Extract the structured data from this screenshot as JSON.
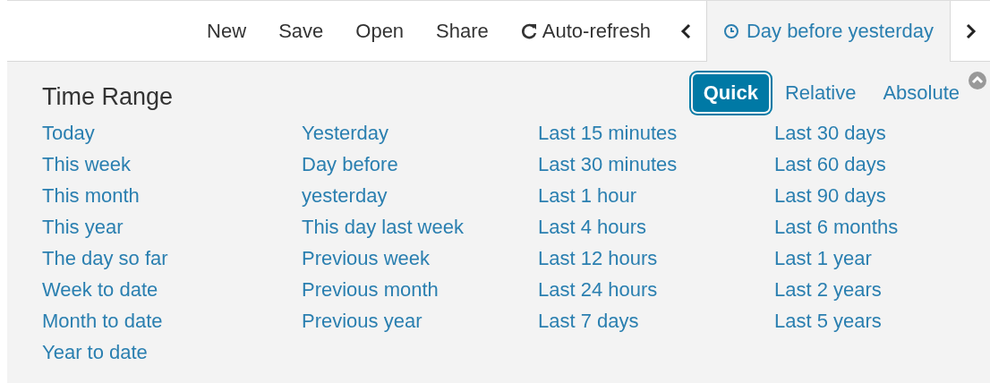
{
  "toolbar": {
    "items": [
      {
        "label": "New",
        "kind": "text"
      },
      {
        "label": "Save",
        "kind": "text"
      },
      {
        "label": "Open",
        "kind": "text"
      },
      {
        "label": "Share",
        "kind": "text"
      },
      {
        "label": "Auto-refresh",
        "kind": "refresh"
      }
    ],
    "time_picker": {
      "label": "Day before yesterday",
      "expanded": true
    }
  },
  "panel": {
    "title": "Time Range",
    "modes": [
      {
        "label": "Quick",
        "selected": true
      },
      {
        "label": "Relative",
        "selected": false
      },
      {
        "label": "Absolute",
        "selected": false
      }
    ],
    "columns": [
      [
        "Today",
        "This week",
        "This month",
        "This year",
        "The day so far",
        "Week to date",
        "Month to date",
        "Year to date"
      ],
      [
        "Yesterday",
        "Day before yesterday",
        "This day last week",
        "Previous week",
        "Previous month",
        "Previous year"
      ],
      [
        "Last 15 minutes",
        "Last 30 minutes",
        "Last 1 hour",
        "Last 4 hours",
        "Last 12 hours",
        "Last 24 hours",
        "Last 7 days"
      ],
      [
        "Last 30 days",
        "Last 60 days",
        "Last 90 days",
        "Last 6 months",
        "Last 1 year",
        "Last 2 years",
        "Last 5 years"
      ]
    ]
  }
}
